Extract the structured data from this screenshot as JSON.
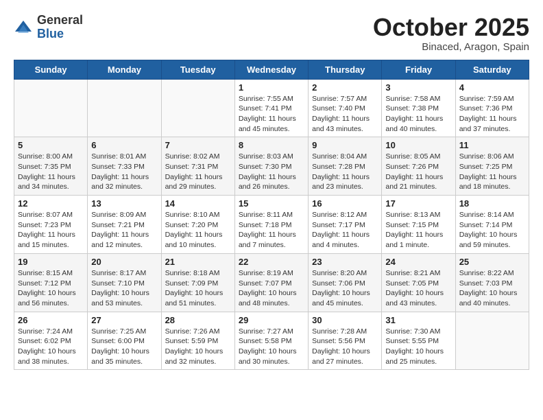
{
  "header": {
    "logo_general": "General",
    "logo_blue": "Blue",
    "month": "October 2025",
    "location": "Binaced, Aragon, Spain"
  },
  "weekdays": [
    "Sunday",
    "Monday",
    "Tuesday",
    "Wednesday",
    "Thursday",
    "Friday",
    "Saturday"
  ],
  "weeks": [
    [
      {
        "day": "",
        "info": ""
      },
      {
        "day": "",
        "info": ""
      },
      {
        "day": "",
        "info": ""
      },
      {
        "day": "1",
        "info": "Sunrise: 7:55 AM\nSunset: 7:41 PM\nDaylight: 11 hours and 45 minutes."
      },
      {
        "day": "2",
        "info": "Sunrise: 7:57 AM\nSunset: 7:40 PM\nDaylight: 11 hours and 43 minutes."
      },
      {
        "day": "3",
        "info": "Sunrise: 7:58 AM\nSunset: 7:38 PM\nDaylight: 11 hours and 40 minutes."
      },
      {
        "day": "4",
        "info": "Sunrise: 7:59 AM\nSunset: 7:36 PM\nDaylight: 11 hours and 37 minutes."
      }
    ],
    [
      {
        "day": "5",
        "info": "Sunrise: 8:00 AM\nSunset: 7:35 PM\nDaylight: 11 hours and 34 minutes."
      },
      {
        "day": "6",
        "info": "Sunrise: 8:01 AM\nSunset: 7:33 PM\nDaylight: 11 hours and 32 minutes."
      },
      {
        "day": "7",
        "info": "Sunrise: 8:02 AM\nSunset: 7:31 PM\nDaylight: 11 hours and 29 minutes."
      },
      {
        "day": "8",
        "info": "Sunrise: 8:03 AM\nSunset: 7:30 PM\nDaylight: 11 hours and 26 minutes."
      },
      {
        "day": "9",
        "info": "Sunrise: 8:04 AM\nSunset: 7:28 PM\nDaylight: 11 hours and 23 minutes."
      },
      {
        "day": "10",
        "info": "Sunrise: 8:05 AM\nSunset: 7:26 PM\nDaylight: 11 hours and 21 minutes."
      },
      {
        "day": "11",
        "info": "Sunrise: 8:06 AM\nSunset: 7:25 PM\nDaylight: 11 hours and 18 minutes."
      }
    ],
    [
      {
        "day": "12",
        "info": "Sunrise: 8:07 AM\nSunset: 7:23 PM\nDaylight: 11 hours and 15 minutes."
      },
      {
        "day": "13",
        "info": "Sunrise: 8:09 AM\nSunset: 7:21 PM\nDaylight: 11 hours and 12 minutes."
      },
      {
        "day": "14",
        "info": "Sunrise: 8:10 AM\nSunset: 7:20 PM\nDaylight: 11 hours and 10 minutes."
      },
      {
        "day": "15",
        "info": "Sunrise: 8:11 AM\nSunset: 7:18 PM\nDaylight: 11 hours and 7 minutes."
      },
      {
        "day": "16",
        "info": "Sunrise: 8:12 AM\nSunset: 7:17 PM\nDaylight: 11 hours and 4 minutes."
      },
      {
        "day": "17",
        "info": "Sunrise: 8:13 AM\nSunset: 7:15 PM\nDaylight: 11 hours and 1 minute."
      },
      {
        "day": "18",
        "info": "Sunrise: 8:14 AM\nSunset: 7:14 PM\nDaylight: 10 hours and 59 minutes."
      }
    ],
    [
      {
        "day": "19",
        "info": "Sunrise: 8:15 AM\nSunset: 7:12 PM\nDaylight: 10 hours and 56 minutes."
      },
      {
        "day": "20",
        "info": "Sunrise: 8:17 AM\nSunset: 7:10 PM\nDaylight: 10 hours and 53 minutes."
      },
      {
        "day": "21",
        "info": "Sunrise: 8:18 AM\nSunset: 7:09 PM\nDaylight: 10 hours and 51 minutes."
      },
      {
        "day": "22",
        "info": "Sunrise: 8:19 AM\nSunset: 7:07 PM\nDaylight: 10 hours and 48 minutes."
      },
      {
        "day": "23",
        "info": "Sunrise: 8:20 AM\nSunset: 7:06 PM\nDaylight: 10 hours and 45 minutes."
      },
      {
        "day": "24",
        "info": "Sunrise: 8:21 AM\nSunset: 7:05 PM\nDaylight: 10 hours and 43 minutes."
      },
      {
        "day": "25",
        "info": "Sunrise: 8:22 AM\nSunset: 7:03 PM\nDaylight: 10 hours and 40 minutes."
      }
    ],
    [
      {
        "day": "26",
        "info": "Sunrise: 7:24 AM\nSunset: 6:02 PM\nDaylight: 10 hours and 38 minutes."
      },
      {
        "day": "27",
        "info": "Sunrise: 7:25 AM\nSunset: 6:00 PM\nDaylight: 10 hours and 35 minutes."
      },
      {
        "day": "28",
        "info": "Sunrise: 7:26 AM\nSunset: 5:59 PM\nDaylight: 10 hours and 32 minutes."
      },
      {
        "day": "29",
        "info": "Sunrise: 7:27 AM\nSunset: 5:58 PM\nDaylight: 10 hours and 30 minutes."
      },
      {
        "day": "30",
        "info": "Sunrise: 7:28 AM\nSunset: 5:56 PM\nDaylight: 10 hours and 27 minutes."
      },
      {
        "day": "31",
        "info": "Sunrise: 7:30 AM\nSunset: 5:55 PM\nDaylight: 10 hours and 25 minutes."
      },
      {
        "day": "",
        "info": ""
      }
    ]
  ]
}
